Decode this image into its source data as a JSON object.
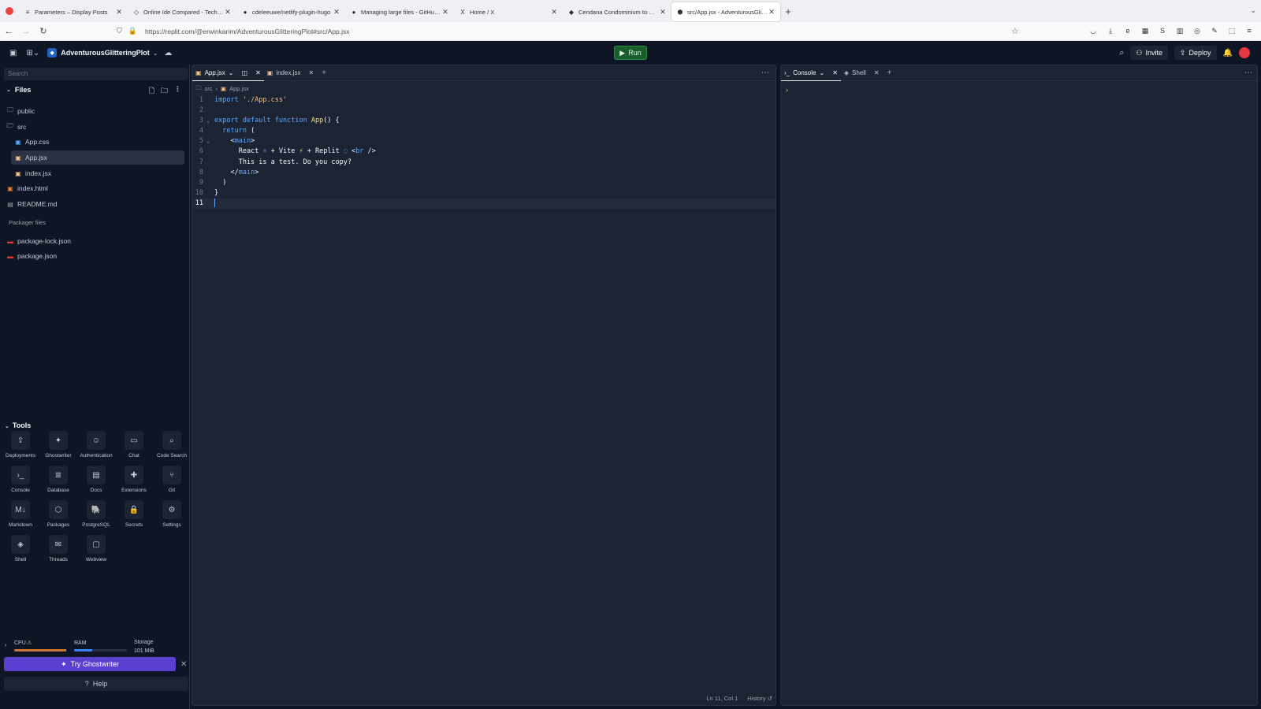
{
  "browser": {
    "tabs": [
      {
        "label": "Parameters – Display Posts",
        "favicon": "≡"
      },
      {
        "label": "Online Ide Compared - Tech Jo",
        "favicon": "◇"
      },
      {
        "label": "cdeleeuwe/netlify-plugin-hugo",
        "favicon": "●"
      },
      {
        "label": "Managing large files - GitHub D",
        "favicon": "●"
      },
      {
        "label": "Home / X",
        "favicon": "X"
      },
      {
        "label": "Cendana Condominium to Our L",
        "favicon": "◆"
      },
      {
        "label": "src/App.jsx - AdventurousGlitte",
        "favicon": "⬢"
      }
    ],
    "active_tab": 6,
    "url": "https://replit.com/@erwinkarim/AdventurousGlitteringPlot#src/App.jsx"
  },
  "header": {
    "repl_name": "AdventurousGlitteringPlot",
    "run_label": "Run",
    "invite_label": "Invite",
    "deploy_label": "Deploy"
  },
  "sidebar": {
    "search_placeholder": "Search",
    "files_title": "Files",
    "tree": [
      {
        "name": "public",
        "icon": "folder-icon"
      },
      {
        "name": "src",
        "icon": "folder-open-icon"
      },
      {
        "name": "App.css",
        "icon": "css-file-icon"
      },
      {
        "name": "App.jsx",
        "icon": "jsx-file-icon"
      },
      {
        "name": "index.jsx",
        "icon": "jsx-file-icon"
      },
      {
        "name": "index.html",
        "icon": "html-file-icon"
      },
      {
        "name": "README.md",
        "icon": "markdown-file-icon"
      }
    ],
    "packager_label": "Packager files",
    "packager_files": [
      {
        "name": "package-lock.json",
        "icon": "npm-icon"
      },
      {
        "name": "package.json",
        "icon": "npm-icon"
      }
    ],
    "tools_title": "Tools",
    "tools": [
      {
        "label": "Deployments",
        "icon": "deployments-icon",
        "glyph": "⇪"
      },
      {
        "label": "Ghostwriter",
        "icon": "ghostwriter-icon",
        "glyph": "✦"
      },
      {
        "label": "Authentication",
        "icon": "user-icon",
        "glyph": "☺"
      },
      {
        "label": "Chat",
        "icon": "chat-icon",
        "glyph": "▭"
      },
      {
        "label": "Code Search",
        "icon": "search-icon",
        "glyph": "⌕"
      },
      {
        "label": "Console",
        "icon": "terminal-icon",
        "glyph": "›_"
      },
      {
        "label": "Database",
        "icon": "database-icon",
        "glyph": "≣"
      },
      {
        "label": "Docs",
        "icon": "docs-icon",
        "glyph": "▤"
      },
      {
        "label": "Extensions",
        "icon": "extensions-icon",
        "glyph": "✚"
      },
      {
        "label": "Git",
        "icon": "git-icon",
        "glyph": "⑂"
      },
      {
        "label": "Markdown",
        "icon": "markdown-icon",
        "glyph": "M↓"
      },
      {
        "label": "Packages",
        "icon": "package-icon",
        "glyph": "⬡"
      },
      {
        "label": "PostgreSQL",
        "icon": "postgresql-icon",
        "glyph": "🐘"
      },
      {
        "label": "Secrets",
        "icon": "lock-icon",
        "glyph": "🔒"
      },
      {
        "label": "Settings",
        "icon": "gear-icon",
        "glyph": "⚙"
      },
      {
        "label": "Shell",
        "icon": "shell-icon",
        "glyph": "◈"
      },
      {
        "label": "Threads",
        "icon": "threads-icon",
        "glyph": "✉"
      },
      {
        "label": "Webview",
        "icon": "monitor-icon",
        "glyph": "▢"
      }
    ],
    "resources": {
      "cpu_label": "CPU",
      "ram_label": "RAM",
      "storage_label": "Storage",
      "storage_value": "101 MiB",
      "cpu_fraction": 0.98,
      "ram_fraction": 0.35
    },
    "ghostwriter_label": "Try Ghostwriter",
    "help_label": "Help"
  },
  "editor": {
    "tabs": [
      {
        "label": "App.jsx",
        "active": true
      },
      {
        "label": "index.jsx",
        "active": false
      }
    ],
    "breadcrumb": [
      "src",
      "App.jsx"
    ],
    "status_position": "Ln 11, Col 1",
    "history_label": "History",
    "current_line": 11,
    "lines": [
      [
        {
          "t": "import ",
          "c": "k"
        },
        {
          "t": "'./App.css'",
          "c": "s"
        }
      ],
      [],
      [
        {
          "t": "export default function ",
          "c": "k"
        },
        {
          "t": "App",
          "c": "f"
        },
        {
          "t": "() {",
          "c": "p"
        }
      ],
      [
        {
          "t": "  return ",
          "c": "k"
        },
        {
          "t": "(",
          "c": "p"
        }
      ],
      [
        {
          "t": "    <",
          "c": "p"
        },
        {
          "t": "main",
          "c": "t"
        },
        {
          "t": ">",
          "c": "p"
        }
      ],
      [
        {
          "t": "      React ",
          "c": "p"
        },
        {
          "t": "⚛",
          "c": "t"
        },
        {
          "t": " + Vite ",
          "c": "p"
        },
        {
          "t": "⚡",
          "c": "f"
        },
        {
          "t": " + Replit ",
          "c": "p"
        },
        {
          "t": "◌",
          "c": "t"
        },
        {
          "t": " <",
          "c": "p"
        },
        {
          "t": "br",
          "c": "t"
        },
        {
          "t": " />",
          "c": "p"
        }
      ],
      [
        {
          "t": "      This is a test. Do you copy?",
          "c": "p"
        }
      ],
      [
        {
          "t": "    </",
          "c": "p"
        },
        {
          "t": "main",
          "c": "t"
        },
        {
          "t": ">",
          "c": "p"
        }
      ],
      [
        {
          "t": "  )",
          "c": "p"
        }
      ],
      [
        {
          "t": "}",
          "c": "p"
        }
      ],
      []
    ],
    "fold_lines": [
      3,
      5
    ]
  },
  "console": {
    "tabs": [
      {
        "label": "Console",
        "active": true
      },
      {
        "label": "Shell",
        "active": false
      }
    ],
    "prompt": "›"
  }
}
